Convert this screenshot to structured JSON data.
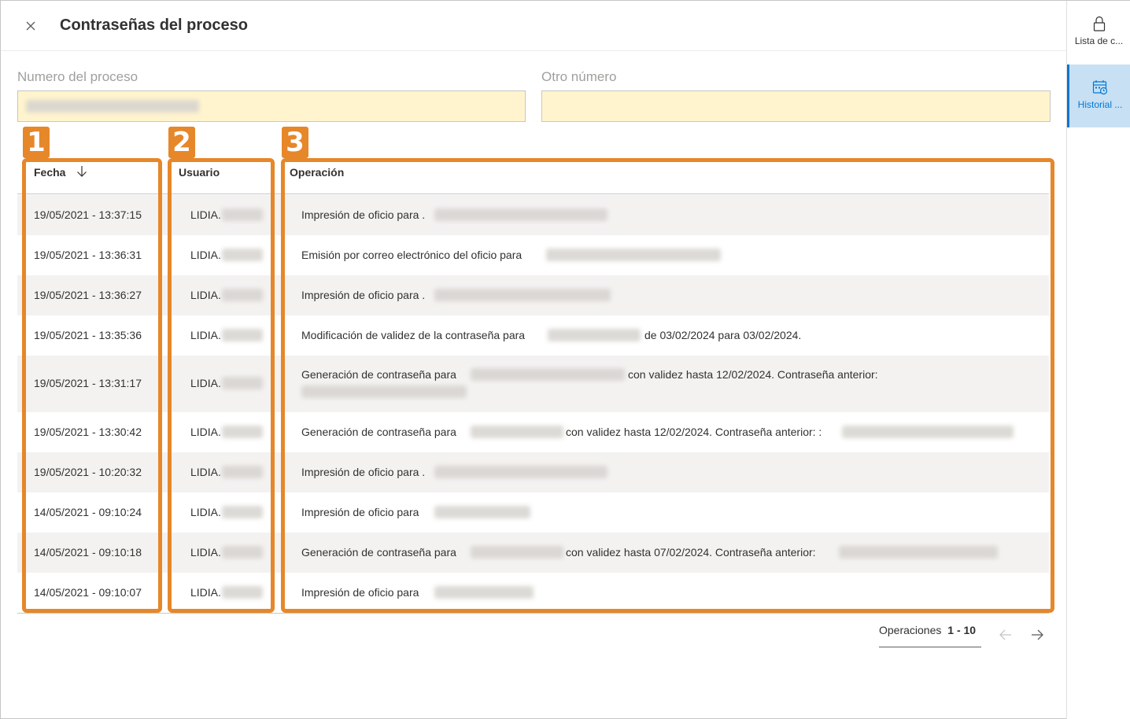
{
  "dialog": {
    "title": "Contraseñas del proceso",
    "close_label": "Cerrar"
  },
  "rail": {
    "items": [
      {
        "label": "Lista de c...",
        "icon": "lock-icon",
        "active": false
      },
      {
        "label": "Historial ...",
        "icon": "calendar-clock-icon",
        "active": true
      }
    ]
  },
  "fields": {
    "process_number_label": "Numero del proceso",
    "other_number_label": "Otro número"
  },
  "table": {
    "columns": [
      "Fecha",
      "Usuario",
      "Operación"
    ],
    "rows": [
      {
        "date": "19/05/2021 - 13:37:15",
        "user": "LIDIA.",
        "op": "Impresión de oficio para ."
      },
      {
        "date": "19/05/2021 - 13:36:31",
        "user": "LIDIA.",
        "op": "Emisión por correo electrónico del oficio para"
      },
      {
        "date": "19/05/2021 - 13:36:27",
        "user": "LIDIA.",
        "op": "Impresión de oficio para ."
      },
      {
        "date": "19/05/2021 - 13:35:36",
        "user": "LIDIA.",
        "op": "Modificación de validez de la contraseña para",
        "op_after": "de 03/02/2024 para 03/02/2024."
      },
      {
        "date": "19/05/2021 - 13:31:17",
        "user": "LIDIA.",
        "op": "Generación de contraseña para",
        "op_after": "con validez hasta 12/02/2024. Contraseña anterior:"
      },
      {
        "date": "19/05/2021 - 13:30:42",
        "user": "LIDIA.",
        "op": "Generación de contraseña para",
        "op_after": "con validez hasta 12/02/2024. Contraseña anterior: :"
      },
      {
        "date": "19/05/2021 - 10:20:32",
        "user": "LIDIA.",
        "op": "Impresión de oficio para ."
      },
      {
        "date": "14/05/2021 - 09:10:24",
        "user": "LIDIA.",
        "op": "Impresión de oficio para"
      },
      {
        "date": "14/05/2021 - 09:10:18",
        "user": "LIDIA.",
        "op": "Generación de contraseña para",
        "op_after": "con validez hasta 07/02/2024. Contraseña anterior:"
      },
      {
        "date": "14/05/2021 - 09:10:07",
        "user": "LIDIA.",
        "op": "Impresión de oficio para"
      }
    ]
  },
  "pagination": {
    "label": "Operaciones",
    "range": "1 - 10"
  },
  "annotations": [
    "1",
    "2",
    "3"
  ],
  "colors": {
    "accent": "#0078d4",
    "annotation": "#e6872a",
    "field_bg": "#fff4ce",
    "row_alt": "#f3f2f1"
  }
}
